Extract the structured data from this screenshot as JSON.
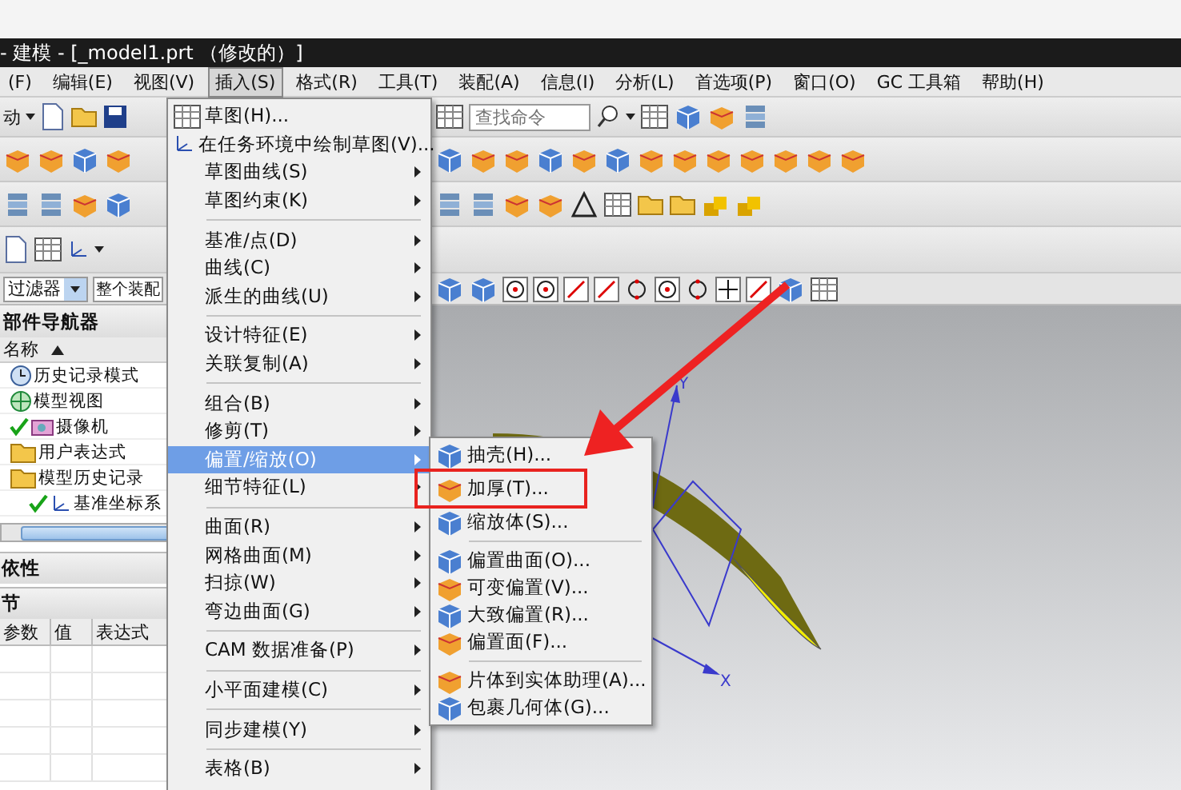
{
  "window": {
    "title": "- 建模 - [_model1.prt （修改的）]"
  },
  "menubar": [
    {
      "label": "(F)",
      "selected": false
    },
    {
      "label": "编辑(E)",
      "selected": false
    },
    {
      "label": "视图(V)",
      "selected": false
    },
    {
      "label": "插入(S)",
      "selected": true
    },
    {
      "label": "格式(R)",
      "selected": false
    },
    {
      "label": "工具(T)",
      "selected": false
    },
    {
      "label": "装配(A)",
      "selected": false
    },
    {
      "label": "信息(I)",
      "selected": false
    },
    {
      "label": "分析(L)",
      "selected": false
    },
    {
      "label": "首选项(P)",
      "selected": false
    },
    {
      "label": "窗口(O)",
      "selected": false
    },
    {
      "label": "GC 工具箱",
      "selected": false
    },
    {
      "label": "帮助(H)",
      "selected": false
    }
  ],
  "toolbar": {
    "start_label": "动",
    "search": {
      "placeholder": "查找命令"
    }
  },
  "selection_bar": {
    "filter": "过滤器",
    "scope": "整个装配"
  },
  "navigator": {
    "title": "部件导航器",
    "column": "名称",
    "tree": [
      {
        "label": "历史记录模式",
        "kind": "clock",
        "checked": false
      },
      {
        "label": "模型视图",
        "kind": "view",
        "checked": false
      },
      {
        "label": "摄像机",
        "kind": "camera",
        "checked": true
      },
      {
        "label": "用户表达式",
        "kind": "folder",
        "checked": false
      },
      {
        "label": "模型历史记录",
        "kind": "folder",
        "checked": false,
        "children": [
          {
            "label": "基准坐标系",
            "kind": "csys",
            "checked": true
          }
        ]
      }
    ]
  },
  "dependencies": {
    "title": "依性"
  },
  "details": {
    "title": "节",
    "columns": [
      "参数",
      "值",
      "表达式"
    ]
  },
  "insert_menu": {
    "items": [
      {
        "kind": "command",
        "label": "草图(H)...",
        "selected": false
      },
      {
        "kind": "command",
        "label": "在任务环境中绘制草图(V)...",
        "selected": false
      },
      {
        "kind": "submenu",
        "label": "草图曲线(S)",
        "selected": false
      },
      {
        "kind": "submenu",
        "label": "草图约束(K)",
        "selected": false
      },
      {
        "kind": "separator"
      },
      {
        "kind": "submenu",
        "label": "基准/点(D)",
        "selected": false
      },
      {
        "kind": "submenu",
        "label": "曲线(C)",
        "selected": false
      },
      {
        "kind": "submenu",
        "label": "派生的曲线(U)",
        "selected": false
      },
      {
        "kind": "separator"
      },
      {
        "kind": "submenu",
        "label": "设计特征(E)",
        "selected": false
      },
      {
        "kind": "submenu",
        "label": "关联复制(A)",
        "selected": false
      },
      {
        "kind": "separator"
      },
      {
        "kind": "submenu",
        "label": "组合(B)",
        "selected": false
      },
      {
        "kind": "submenu",
        "label": "修剪(T)",
        "selected": false
      },
      {
        "kind": "submenu",
        "label": "偏置/缩放(O)",
        "selected": true
      },
      {
        "kind": "submenu",
        "label": "细节特征(L)",
        "selected": false
      },
      {
        "kind": "separator"
      },
      {
        "kind": "submenu",
        "label": "曲面(R)",
        "selected": false
      },
      {
        "kind": "submenu",
        "label": "网格曲面(M)",
        "selected": false
      },
      {
        "kind": "submenu",
        "label": "扫掠(W)",
        "selected": false
      },
      {
        "kind": "submenu",
        "label": "弯边曲面(G)",
        "selected": false
      },
      {
        "kind": "separator"
      },
      {
        "kind": "submenu",
        "label": "CAM 数据准备(P)",
        "selected": false
      },
      {
        "kind": "separator"
      },
      {
        "kind": "submenu",
        "label": "小平面建模(C)",
        "selected": false
      },
      {
        "kind": "separator"
      },
      {
        "kind": "submenu",
        "label": "同步建模(Y)",
        "selected": false
      },
      {
        "kind": "separator"
      },
      {
        "kind": "submenu",
        "label": "表格(B)",
        "selected": false
      }
    ]
  },
  "submenu": {
    "items": [
      {
        "kind": "command",
        "label": "抽壳(H)...",
        "highlighted": false
      },
      {
        "kind": "command",
        "label": "加厚(T)...",
        "highlighted": true
      },
      {
        "kind": "command",
        "label": "缩放体(S)...",
        "highlighted": false
      },
      {
        "kind": "separator"
      },
      {
        "kind": "command",
        "label": "偏置曲面(O)...",
        "highlighted": false
      },
      {
        "kind": "command",
        "label": "可变偏置(V)...",
        "highlighted": false
      },
      {
        "kind": "command",
        "label": "大致偏置(R)...",
        "highlighted": false
      },
      {
        "kind": "command",
        "label": "偏置面(F)...",
        "highlighted": false
      },
      {
        "kind": "separator"
      },
      {
        "kind": "command",
        "label": "片体到实体助理(A)...",
        "highlighted": false
      },
      {
        "kind": "command",
        "label": "包裹几何体(G)...",
        "highlighted": false
      }
    ]
  },
  "canvas": {
    "axis_labels": [
      "Y",
      "X"
    ]
  }
}
